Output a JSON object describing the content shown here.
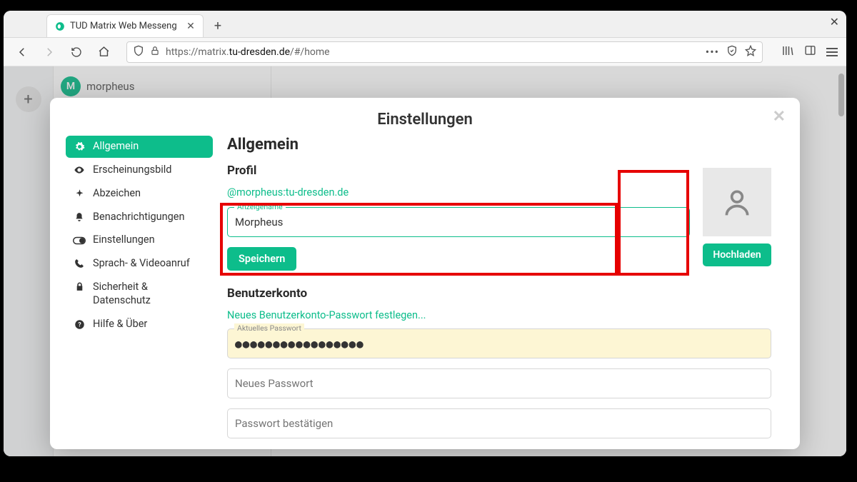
{
  "browser": {
    "tab_title": "TUD Matrix Web Messeng",
    "url_prefix": "https://matrix.",
    "url_host": "tu-dresden.de",
    "url_suffix": "/#/home"
  },
  "background": {
    "room_initial": "M",
    "room_name": "morpheus"
  },
  "modal": {
    "title": "Einstellungen",
    "nav": [
      {
        "label": "Allgemein",
        "icon": "gear"
      },
      {
        "label": "Erscheinungsbild",
        "icon": "eye"
      },
      {
        "label": "Abzeichen",
        "icon": "sparkle"
      },
      {
        "label": "Benachrichtigungen",
        "icon": "bell"
      },
      {
        "label": "Einstellungen",
        "icon": "toggle"
      },
      {
        "label": "Sprach- & Videoanruf",
        "icon": "phone"
      },
      {
        "label": "Sicherheit & Datenschutz",
        "icon": "lock"
      },
      {
        "label": "Hilfe & Über",
        "icon": "help"
      }
    ]
  },
  "general": {
    "heading": "Allgemein",
    "profile_heading": "Profil",
    "mxid": "@morpheus:tu-dresden.de",
    "displayname_label": "Anzeigename",
    "displayname_value": "Morpheus",
    "save_label": "Speichern",
    "upload_label": "Hochladen",
    "account_heading": "Benutzerkonto",
    "set_password_link": "Neues Benutzerkonto-Passwort festlegen...",
    "current_pw_label": "Aktuelles Passwort",
    "current_pw_dots": "●●●●●●●●●●●●●●●●●",
    "new_pw_placeholder": "Neues Passwort",
    "confirm_pw_placeholder": "Passwort bestätigen"
  }
}
